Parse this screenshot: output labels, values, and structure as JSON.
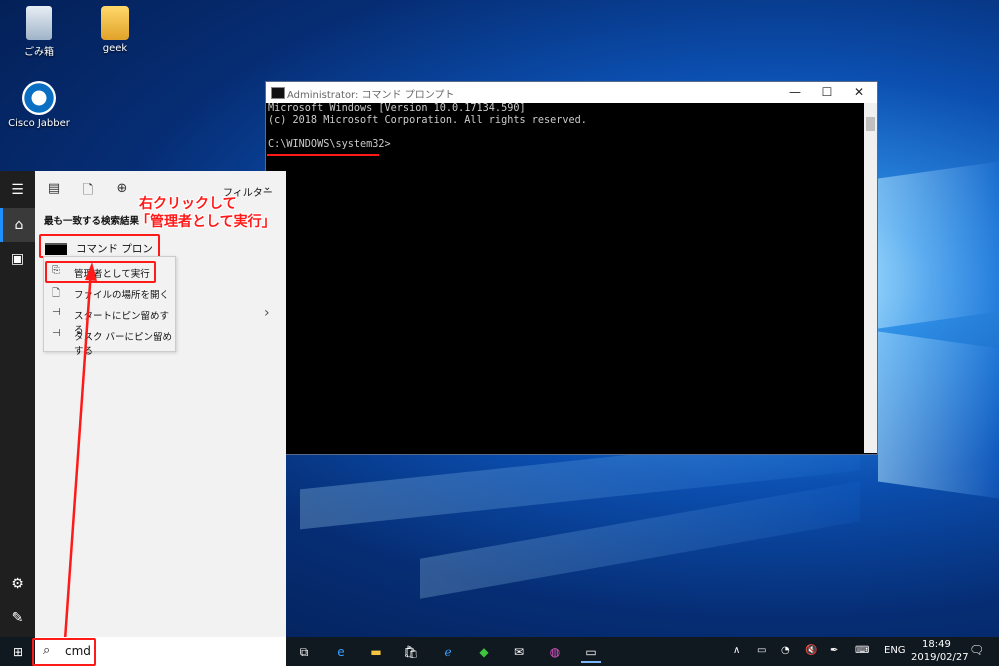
{
  "desktop": {
    "icons": [
      {
        "label": "ごみ箱",
        "name": "recycle-bin-icon"
      },
      {
        "label": "geek",
        "name": "user-folder-icon"
      },
      {
        "label": "Cisco Jabber",
        "name": "cisco-jabber-icon"
      }
    ]
  },
  "cmd_window": {
    "title": "Administrator: コマンド プロンプト",
    "lines": [
      "Microsoft Windows [Version 10.0.17134.590]",
      "(c) 2018 Microsoft Corporation. All rights reserved.",
      "C:\\WINDOWS\\system32>"
    ],
    "minimize": "—",
    "maximize": "☐",
    "close": "✕"
  },
  "start": {
    "filter_label": "フィルター",
    "best_match_heading": "最も一致する検索結果",
    "best_match_item": "コマンド プロンプト",
    "context_menu": [
      {
        "label": "管理者として実行",
        "icon": "run-as-admin-icon"
      },
      {
        "label": "ファイルの場所を開く",
        "icon": "file-icon"
      },
      {
        "label": "スタートにピン留めする",
        "icon": "pin-icon"
      },
      {
        "label": "タスク バーにピン留めする",
        "icon": "pin-icon"
      }
    ]
  },
  "annotation": {
    "line1": "右クリックして",
    "line2": "「管理者として実行」"
  },
  "search": {
    "query": "cmd"
  },
  "taskbar": {
    "language": "ENG",
    "time": "18:49",
    "date": "2019/02/27"
  },
  "colors": {
    "accent_red": "#ff1a1a",
    "taskbar": "#101820",
    "start_rail": "#1f1f1f"
  }
}
